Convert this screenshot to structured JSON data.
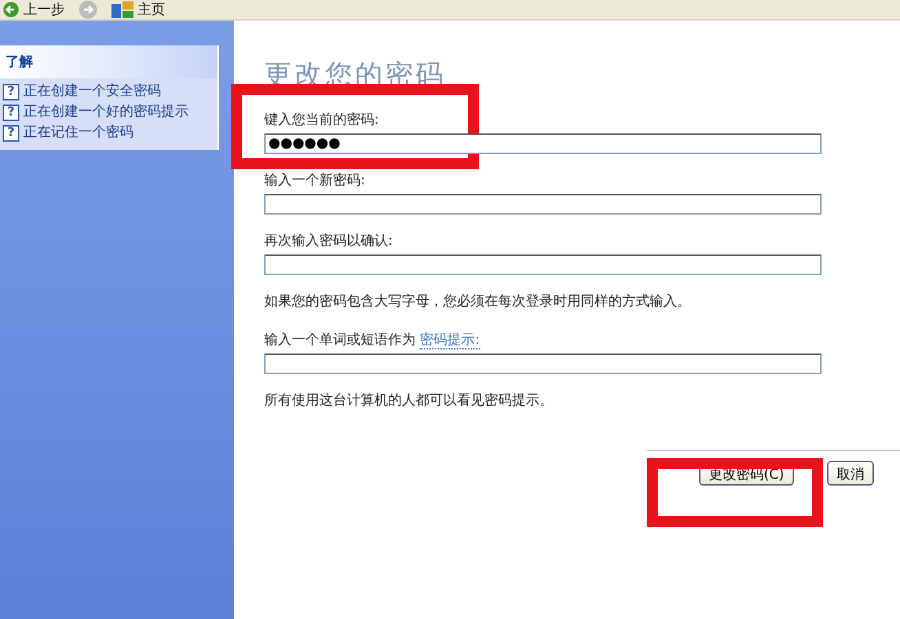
{
  "toolbar": {
    "items": [
      {
        "kind": "back",
        "label": "上一步"
      },
      {
        "kind": "forward"
      },
      {
        "kind": "home",
        "label": "主页"
      }
    ]
  },
  "sidebar": {
    "title": "了解",
    "items": [
      {
        "icon": "?",
        "label": "正在创建一个安全密码"
      },
      {
        "icon": "?",
        "label": "正在创建一个好的密码提示"
      },
      {
        "icon": "?",
        "label": "正在记住一个密码"
      }
    ]
  },
  "form": {
    "title": "更改您的密码",
    "items": [
      {
        "kind": "field",
        "label": "键入您当前的密码:",
        "value": "●●●●●●"
      },
      {
        "kind": "field",
        "label": "输入一个新密码:"
      },
      {
        "kind": "field",
        "label": "再次输入密码以确认:"
      },
      {
        "kind": "note",
        "text": "如果您的密码包含大写字母，您必须在每次登录时用同样的方式输入。"
      },
      {
        "kind": "field",
        "label": "输入一个单词或短语作为",
        "link": "密码提示:"
      },
      {
        "kind": "note",
        "text": "所有使用这台计算机的人都可以看见密码提示。"
      }
    ],
    "buttons": [
      {
        "label": "更改密码(C)"
      },
      {
        "label": "取消"
      }
    ]
  }
}
